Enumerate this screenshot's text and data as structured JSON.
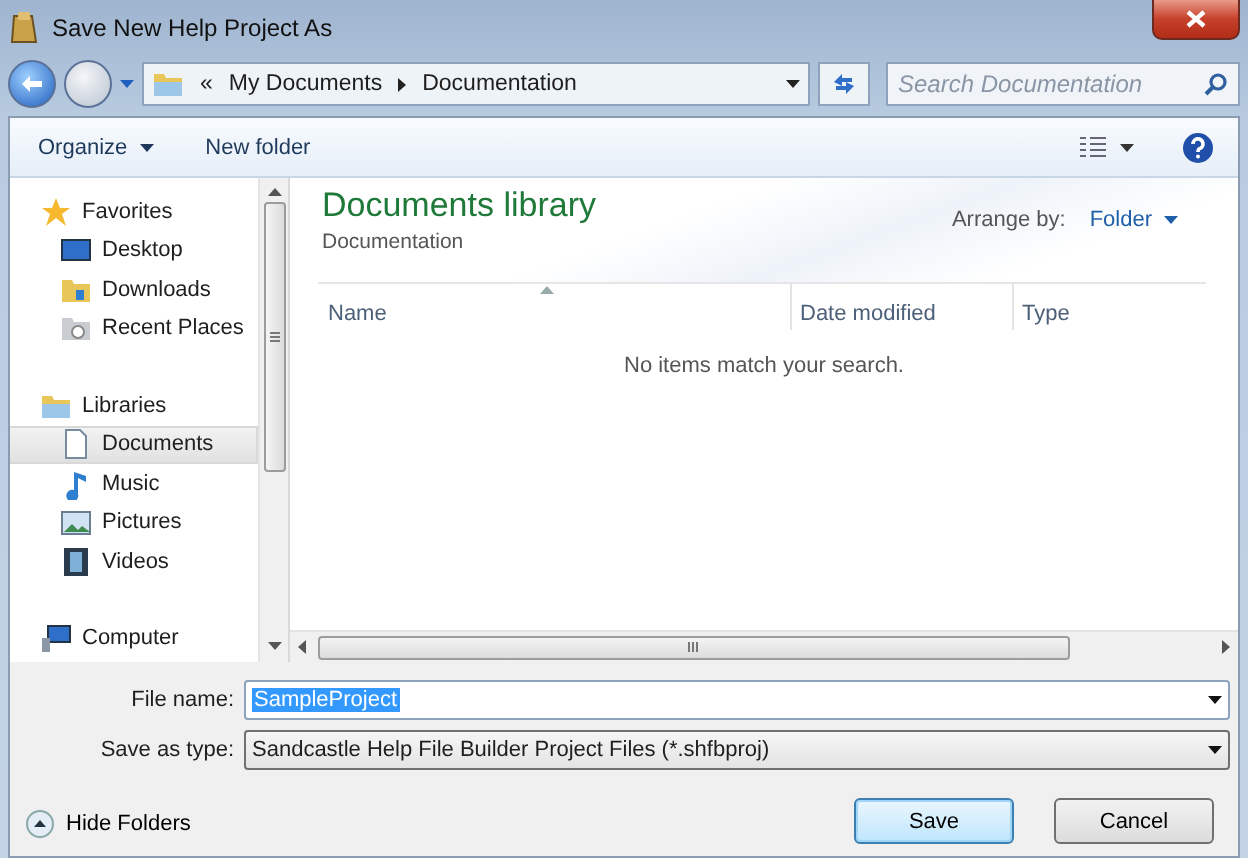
{
  "window": {
    "title": "Save New Help Project As"
  },
  "address": {
    "overflow": "«",
    "path": [
      "My Documents",
      "Documentation"
    ]
  },
  "search": {
    "placeholder": "Search Documentation"
  },
  "toolbar": {
    "organize": "Organize",
    "new_folder": "New folder"
  },
  "sidebar": {
    "groups": [
      {
        "label": "Favorites",
        "children": [
          {
            "label": "Desktop",
            "selected": false
          },
          {
            "label": "Downloads",
            "selected": false
          },
          {
            "label": "Recent Places",
            "selected": false
          }
        ]
      },
      {
        "label": "Libraries",
        "children": [
          {
            "label": "Documents",
            "selected": true
          },
          {
            "label": "Music",
            "selected": false
          },
          {
            "label": "Pictures",
            "selected": false
          },
          {
            "label": "Videos",
            "selected": false
          }
        ]
      },
      {
        "label": "Computer"
      }
    ]
  },
  "library": {
    "title": "Documents library",
    "subtitle": "Documentation",
    "arrange_label": "Arrange by:",
    "arrange_value": "Folder"
  },
  "table": {
    "columns": [
      "Name",
      "Date modified",
      "Type"
    ],
    "empty_message": "No items match your search."
  },
  "form": {
    "file_name_label": "File name:",
    "file_name": "SampleProject",
    "type_label": "Save as type:",
    "type_value": "Sandcastle Help File Builder Project Files (*.shfbproj)"
  },
  "footer": {
    "hide_folders": "Hide Folders",
    "buttons": [
      {
        "label": "Save",
        "default": true
      },
      {
        "label": "Cancel",
        "default": false
      }
    ]
  }
}
